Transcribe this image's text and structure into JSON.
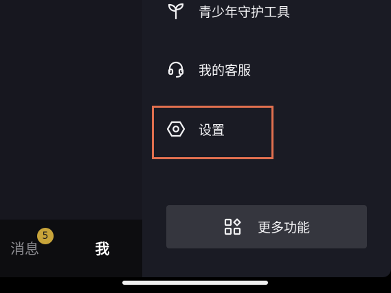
{
  "tabbar": {
    "messages_label": "消息",
    "messages_badge": "5",
    "me_label": "我"
  },
  "drawer": {
    "items": [
      {
        "label": "青少年守护工具",
        "icon": "sprout-icon"
      },
      {
        "label": "我的客服",
        "icon": "headset-icon"
      },
      {
        "label": "设置",
        "icon": "hexagon-settings-icon"
      }
    ],
    "more_button_label": "更多功能",
    "more_button_icon": "grid-apps-icon"
  },
  "colors": {
    "highlight": "#e2704f",
    "badge": "#c8a43a",
    "drawer_bg": "#1a1b24"
  }
}
